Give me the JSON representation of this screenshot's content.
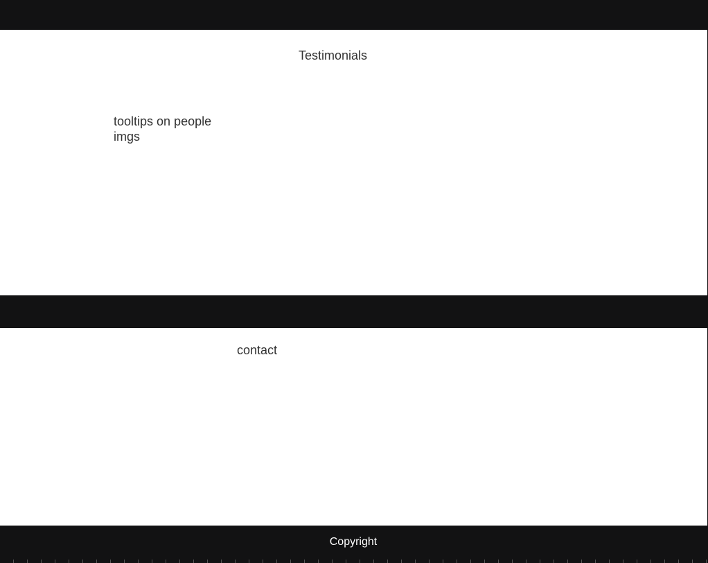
{
  "testimonials": {
    "title": "Testimonials",
    "note": "tooltips on people imgs"
  },
  "contact": {
    "title": "contact"
  },
  "footer": {
    "copyright": "Copyright"
  },
  "colors": {
    "band": "#121213",
    "background": "#ffffff",
    "text": "#333333",
    "footer_text": "#ffffff"
  }
}
